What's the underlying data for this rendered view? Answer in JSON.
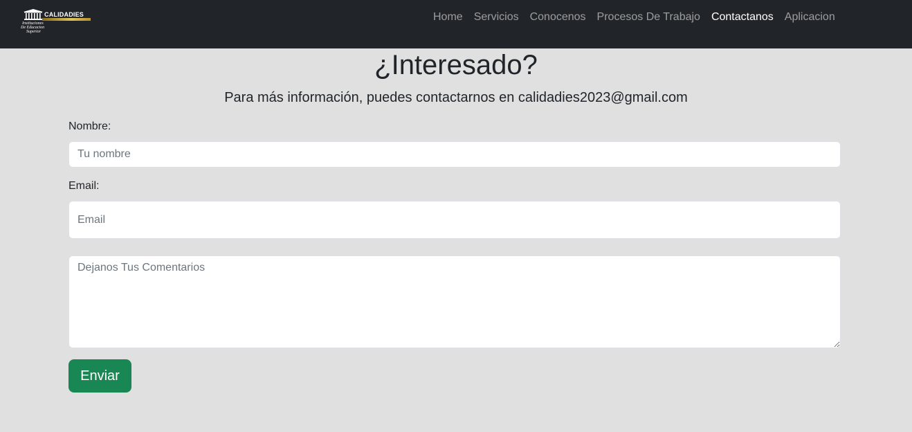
{
  "brand": {
    "name": "CALIDADIES",
    "subtitle_lines": [
      "Instituciones",
      "De Educacion",
      "Superior"
    ]
  },
  "nav": {
    "items": [
      {
        "label": "Home",
        "active": false
      },
      {
        "label": "Servicios",
        "active": false
      },
      {
        "label": "Conocenos",
        "active": false
      },
      {
        "label": "Procesos De Trabajo",
        "active": false
      },
      {
        "label": "Contactanos",
        "active": true
      },
      {
        "label": "Aplicacion",
        "active": false
      }
    ]
  },
  "main": {
    "title": "¿Interesado?",
    "subtitle": "Para más información, puedes contactarnos en calidadies2023@gmail.com"
  },
  "form": {
    "name_label": "Nombre:",
    "name_placeholder": "Tu nombre",
    "email_label": "Email:",
    "email_placeholder": "Email",
    "comments_placeholder": "Dejanos Tus Comentarios",
    "submit_label": "Enviar"
  },
  "colors": {
    "navbar": "#212529",
    "page_background": "#e0e0e0",
    "submit_button": "#198754",
    "logo_gold": "#d4b24c"
  }
}
